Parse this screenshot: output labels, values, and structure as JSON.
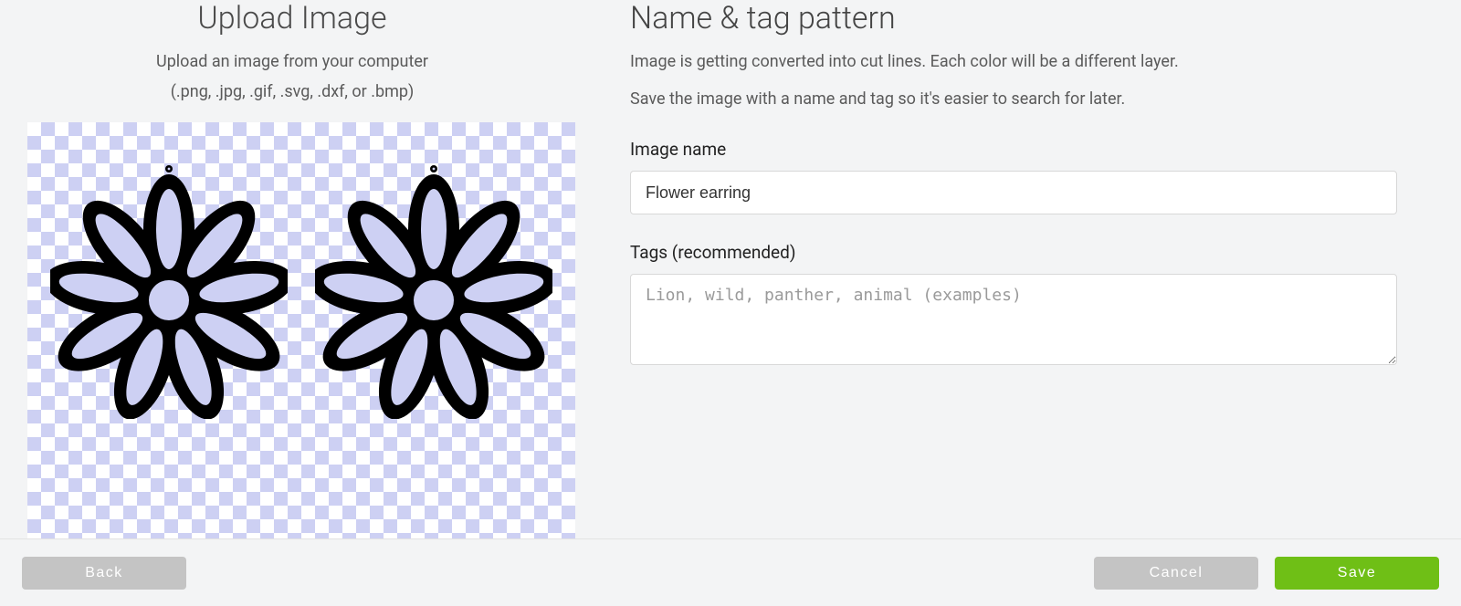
{
  "left": {
    "title": "Upload Image",
    "sub1": "Upload an image from your computer",
    "sub2": "(.png, .jpg, .gif, .svg, .dxf, or .bmp)"
  },
  "right": {
    "title": "Name & tag pattern",
    "sub1": "Image is getting converted into cut lines. Each color will be a different layer.",
    "sub2": "Save the image with a name and tag so it's easier to search for later.",
    "image_name_label": "Image name",
    "image_name_value": "Flower earring",
    "tags_label": "Tags (recommended)",
    "tags_placeholder": "Lion, wild, panther, animal (examples)",
    "tags_value": ""
  },
  "footer": {
    "back": "Back",
    "cancel": "Cancel",
    "save": "Save"
  }
}
